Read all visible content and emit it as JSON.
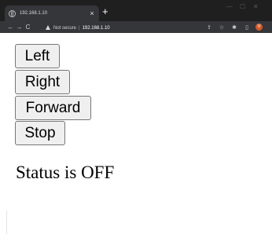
{
  "browser": {
    "tab_title": "192.168.1.10",
    "tab_close": "×",
    "new_tab": "+",
    "window_controls": {
      "minimize": "—",
      "maximize": "☐",
      "close": "✕"
    },
    "nav": {
      "back": "←",
      "forward": "→",
      "reload": "C"
    },
    "security_label": "Not secure",
    "separator": "|",
    "url": "192.168.1.10",
    "profile_initial": "V",
    "right_icons": [
      "share-icon",
      "star-icon",
      "extensions-icon",
      "sidebar-icon"
    ]
  },
  "page": {
    "buttons": {
      "left": "Left",
      "right": "Right",
      "forward": "Forward",
      "stop": "Stop"
    },
    "status": "Status is OFF"
  },
  "colors": {
    "chrome_dark": "#1f1f1f",
    "toolbar": "#35363a",
    "avatar": "#d45a2a",
    "button_bg": "#efefef"
  }
}
